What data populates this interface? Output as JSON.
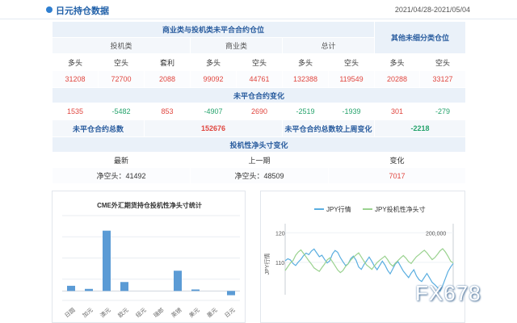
{
  "header": {
    "title": "日元持仓数据",
    "date_range": "2021/04/28-2021/05/04"
  },
  "table": {
    "group_noncommercial_commercial": "商业类与投机类未平合合约仓位",
    "group_other": "其他未细分类仓位",
    "speculative": "投机类",
    "commercial": "商业类",
    "total": "总计",
    "long": "多头",
    "short": "空头",
    "spread": "套利",
    "positions": {
      "spec_long": "31208",
      "spec_short": "72700",
      "spec_spread": "2088",
      "comm_long": "99092",
      "comm_short": "44761",
      "total_long": "132388",
      "total_short": "119549",
      "other_long": "20288",
      "other_short": "33127"
    },
    "change_title": "未平仓合约变化",
    "changes": {
      "spec_long": "1535",
      "spec_short": "-5482",
      "spec_spread": "853",
      "comm_long": "-4907",
      "comm_short": "2690",
      "total_long": "-2519",
      "total_short": "-1939",
      "other_long": "301",
      "other_short": "-279"
    },
    "oi_total_label": "未平仓合约总数",
    "oi_total_value": "152676",
    "oi_change_label": "未平仓合约总数较上周变化",
    "oi_change_value": "-2218",
    "spec_net_title": "投机性净头寸变化",
    "latest_label": "最新",
    "previous_label": "上一期",
    "change_label": "变化",
    "latest_net": "净空头：41492",
    "previous_net": "净空头：48509",
    "net_change": "7017"
  },
  "chart_data": [
    {
      "type": "bar",
      "title": "CME外汇期货持仓投机性净头寸统计",
      "categories": [
        "日圆",
        "加元",
        "澳元",
        "欧元",
        "纽元",
        "瑞郎",
        "英镑",
        "美元",
        "墨元",
        "日元"
      ],
      "values": [
        5500,
        2200,
        64000,
        9500,
        0,
        0,
        21500,
        1600,
        0,
        -4500
      ],
      "ylim": [
        -10000,
        80000
      ],
      "color": "#5b9bd5",
      "grid": true
    },
    {
      "type": "line",
      "legend": [
        "JPY行情",
        "JPY投机性净头寸"
      ],
      "ylabel_left": "JPY行情",
      "yticks_left": [
        "120",
        "110"
      ],
      "ytick_right": "200,000",
      "ylim_left": [
        99,
        122
      ],
      "series": [
        {
          "name": "JPY行情",
          "color": "#5aaee0",
          "values": [
            110.5,
            111.2,
            110.8,
            109.6,
            108.9,
            110.1,
            111.0,
            112.3,
            113.1,
            112.6,
            113.8,
            114.5,
            113.2,
            111.9,
            112.4,
            111.0,
            109.8,
            110.5,
            112.8,
            114.0,
            113.4,
            111.6,
            110.2,
            108.9,
            109.5,
            111.3,
            112.1,
            110.7,
            108.4,
            107.6,
            109.2,
            110.5,
            111.8,
            110.3,
            108.7,
            107.5,
            108.9,
            110.4,
            109.1,
            107.3,
            106.1,
            107.8,
            109.5,
            110.2,
            108.6,
            107.0,
            105.9,
            104.8,
            106.3,
            107.5,
            105.4,
            104.1,
            103.5,
            104.9,
            106.2,
            104.7,
            103.2,
            102.4,
            101.5,
            100.2,
            102.1,
            104.5,
            106.8,
            108.4,
            109.6
          ]
        },
        {
          "name": "JPY投机性净头寸",
          "color": "#9ad28f",
          "values": [
            107.2,
            108.5,
            109.8,
            110.6,
            112.4,
            113.5,
            114.2,
            113.0,
            111.8,
            110.5,
            109.4,
            108.1,
            107.5,
            106.9,
            108.2,
            109.4,
            110.8,
            111.5,
            110.2,
            108.8,
            107.4,
            106.5,
            107.2,
            108.6,
            109.5,
            110.8,
            111.7,
            112.5,
            113.2,
            111.8,
            110.4,
            109.1,
            108.4,
            107.6,
            108.8,
            109.9,
            110.7,
            111.4,
            112.1,
            110.9,
            109.5,
            108.7,
            109.8,
            110.6,
            111.5,
            112.3,
            111.4,
            110.2,
            109.6,
            110.8,
            111.9,
            112.6,
            113.4,
            114.1,
            113.2,
            112.0,
            110.9,
            111.6,
            112.7,
            113.9,
            114.6,
            113.5,
            112.1,
            110.4,
            109.8
          ]
        }
      ]
    }
  ],
  "watermark": "FX678"
}
